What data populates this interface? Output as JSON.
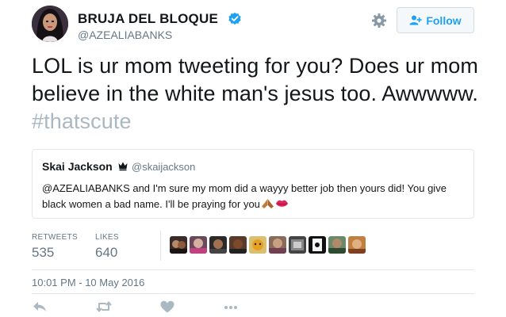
{
  "author": {
    "display_name": "BRUJA DEL BLOQUE",
    "handle": "@AZEALIABANKS",
    "verified": true,
    "avatar_icon": "avatar"
  },
  "header": {
    "settings_icon": "gear-icon",
    "follow_label": "Follow",
    "follow_icon": "add-user-icon"
  },
  "tweet": {
    "text": "LOL is ur mom tweeting for you? Does ur mom believe in the white man's jesus too. Awwwww.",
    "hashtag": "#thatscute"
  },
  "quoted_tweet": {
    "name": "Skai Jackson",
    "badge_icon": "crown-icon",
    "handle": "@skaijackson",
    "text": "@AZEALIABANKS and I'm sure my mom did a wayyy better job then yours did! You give black women a bad name. I'll be praying for you",
    "emojis": [
      "folded-hands-icon",
      "kiss-mark-icon"
    ]
  },
  "stats": {
    "retweets_label": "RETWEETS",
    "retweets_count": "535",
    "likes_label": "LIKES",
    "likes_count": "640",
    "liker_avatars": 10
  },
  "timestamp": "10:01 PM - 10 May 2016",
  "actions": [
    "reply-icon",
    "retweet-icon",
    "like-icon",
    "more-icon"
  ],
  "colors": {
    "brand": "#1da1f2",
    "text": "#14171a",
    "muted": "#657786",
    "hashtag": "#aab8c2",
    "border": "#e1e8ed"
  }
}
